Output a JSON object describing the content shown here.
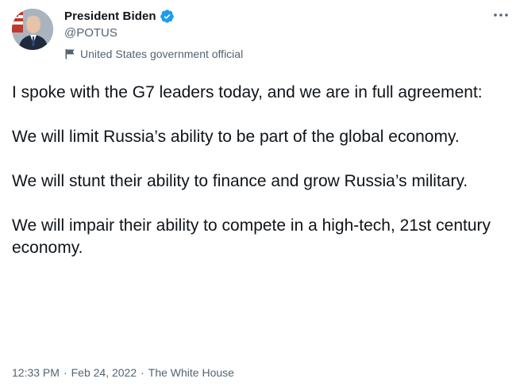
{
  "author": {
    "display_name": "President Biden",
    "handle": "@POTUS",
    "verified": true,
    "label": "United States government official"
  },
  "icons": {
    "verified": "verified-badge-icon",
    "label": "flag-icon",
    "more": "more-horizontal-icon"
  },
  "colors": {
    "text_primary": "#0f1419",
    "text_secondary": "#536471",
    "verified_blue": "#1d9bf0"
  },
  "tweet": {
    "paragraphs": [
      "I spoke with the G7 leaders today, and we are in full agreement:",
      "We will limit Russia’s ability to be part of the global economy.",
      "We will stunt their ability to finance and grow Russia’s military.",
      "We will impair their ability to compete in a high-tech, 21st century economy."
    ],
    "time": "12:33 PM",
    "date": "Feb 24, 2022",
    "source": "The White House",
    "separator": "·"
  }
}
